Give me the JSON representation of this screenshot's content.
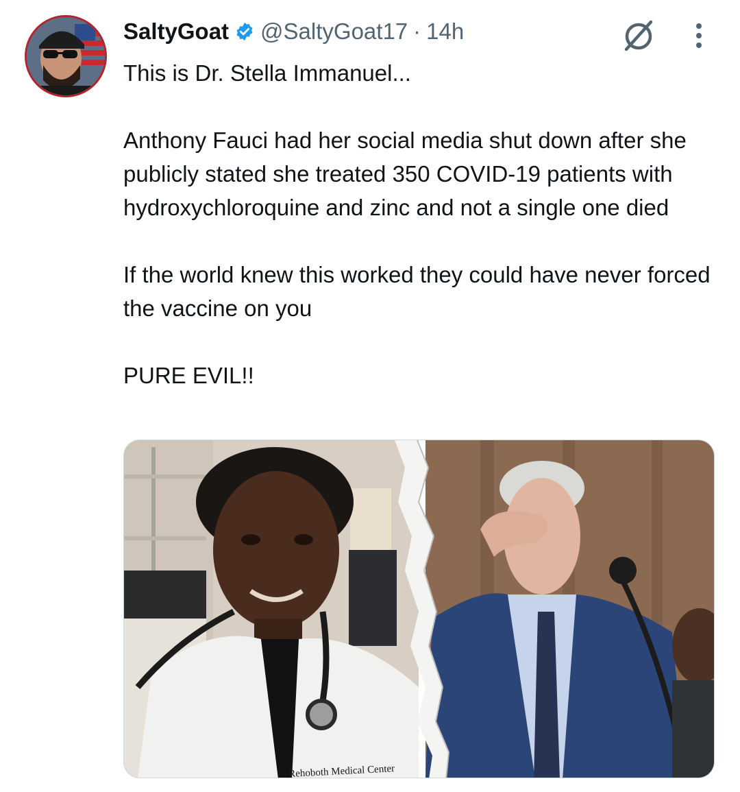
{
  "post": {
    "author": {
      "display_name": "SaltyGoat",
      "handle": "@SaltyGoat17",
      "verified": true,
      "avatar_icon": "user-avatar"
    },
    "separator": "·",
    "timestamp": "14h",
    "paragraphs": [
      "This is Dr. Stella Immanuel...",
      "Anthony Fauci had her social media shut down after she publicly stated she treated 350 COVID-19 patients with hydroxychloroquine and zinc and not a single one died",
      "If the world knew this worked they could have never forced the vaccine on you",
      "PURE EVIL!!"
    ],
    "media": {
      "coat_text": "Rehoboth Medical Center"
    }
  },
  "colors": {
    "text_primary": "#0f1419",
    "text_secondary": "#536471",
    "verified_blue": "#1d9bf0",
    "avatar_border": "#b1262d"
  },
  "icons": {
    "verified": "verified-badge-icon",
    "grok": "grok-icon",
    "more": "more-options-icon"
  }
}
